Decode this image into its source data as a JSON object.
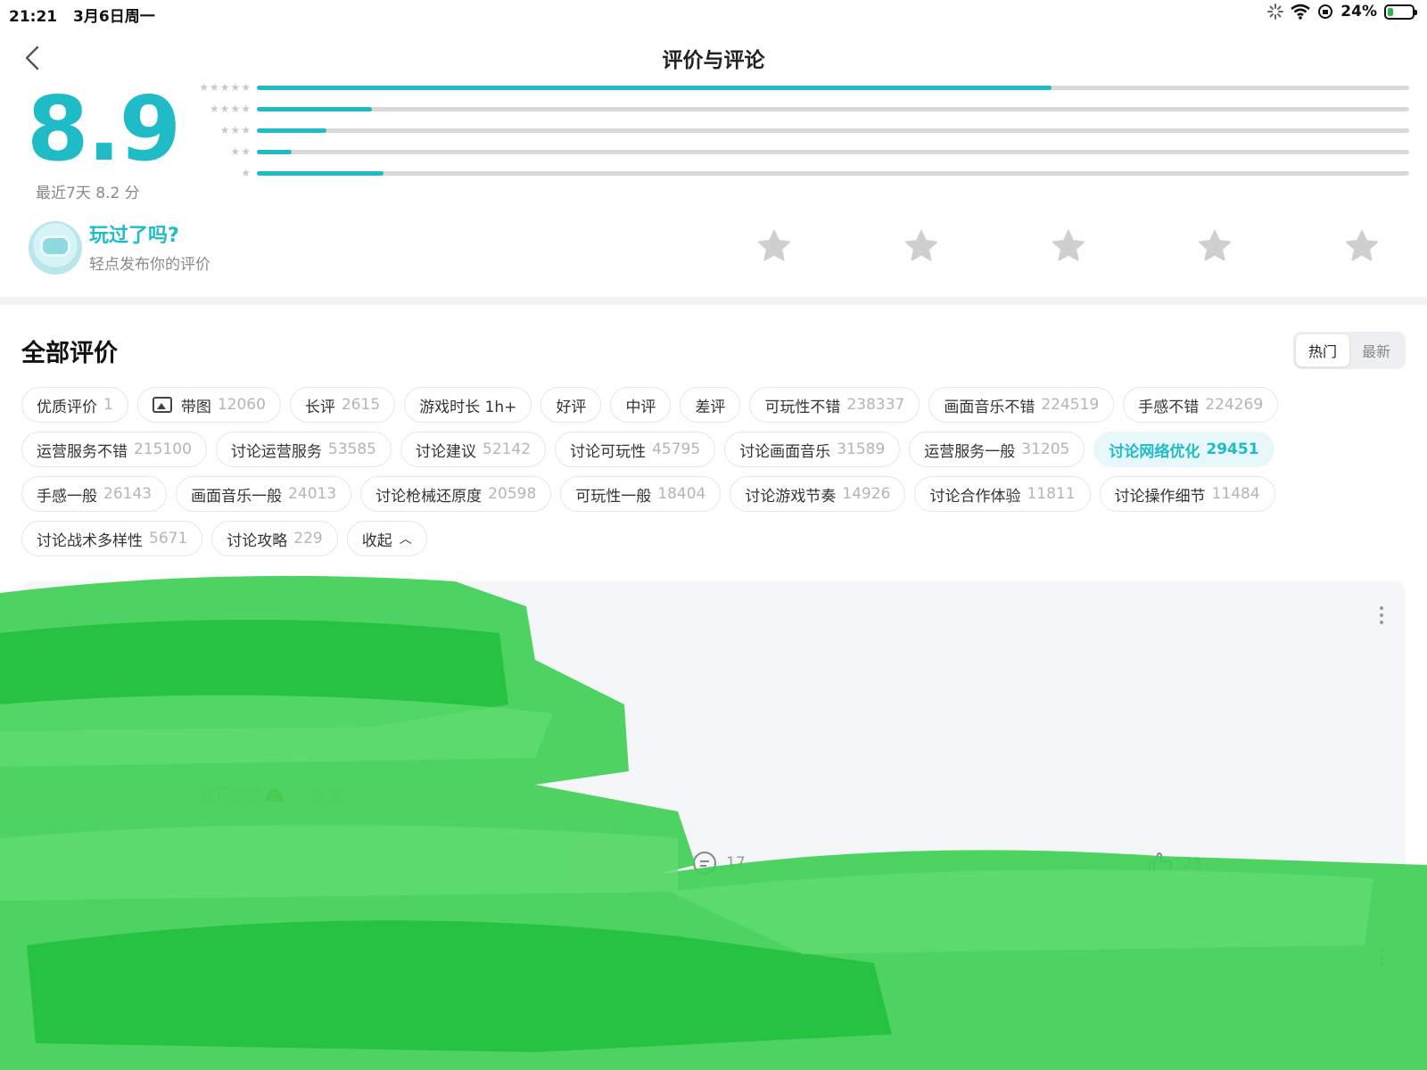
{
  "status_bar": {
    "time": "21:21",
    "date": "3月6日周一",
    "battery": "24%",
    "battery_level": 0.24
  },
  "header": {
    "title": "评价与评论",
    "back_icon": "chevron-left-icon"
  },
  "rating": {
    "score": "8.9",
    "recent": "最近7天 8.2 分",
    "distribution": [
      {
        "stars": 5,
        "fraction": 0.69
      },
      {
        "stars": 4,
        "fraction": 0.1
      },
      {
        "stars": 3,
        "fraction": 0.06
      },
      {
        "stars": 2,
        "fraction": 0.03
      },
      {
        "stars": 1,
        "fraction": 0.11
      }
    ]
  },
  "prompt": {
    "title": "玩过了吗?",
    "subtitle": "轻点发布你的评价"
  },
  "reviews": {
    "title": "全部评价",
    "sort": [
      "热门",
      "最新"
    ],
    "tags": [
      {
        "label": "优质评价",
        "count": "1"
      },
      {
        "label": "带图",
        "count": "12060",
        "icon": "image-icon"
      },
      {
        "label": "长评",
        "count": "2615"
      },
      {
        "label": "游戏时长 1h+",
        "count": ""
      },
      {
        "label": "好评",
        "count": ""
      },
      {
        "label": "中评",
        "count": ""
      },
      {
        "label": "差评",
        "count": ""
      },
      {
        "label": "可玩性不错",
        "count": "238337"
      },
      {
        "label": "画面音乐不错",
        "count": "224519"
      },
      {
        "label": "手感不错",
        "count": "224269"
      },
      {
        "label": "运营服务不错",
        "count": "215100"
      },
      {
        "label": "讨论运营服务",
        "count": "53585"
      },
      {
        "label": "讨论建议",
        "count": "52142"
      },
      {
        "label": "讨论可玩性",
        "count": "45795"
      },
      {
        "label": "讨论画面音乐",
        "count": "31589"
      },
      {
        "label": "运营服务一般",
        "count": "31205"
      },
      {
        "label": "讨论网络优化",
        "count": "29451",
        "selected": true
      },
      {
        "label": "手感一般",
        "count": "26143"
      },
      {
        "label": "画面音乐一般",
        "count": "24013"
      },
      {
        "label": "讨论枪械还原度",
        "count": "20598"
      },
      {
        "label": "可玩性一般",
        "count": "18404"
      },
      {
        "label": "讨论游戏节奏",
        "count": "14926"
      },
      {
        "label": "讨论合作体验",
        "count": "11811"
      },
      {
        "label": "讨论操作细节",
        "count": "11484"
      },
      {
        "label": "讨论战术多样性",
        "count": "5671"
      },
      {
        "label": "讨论攻略",
        "count": "229"
      }
    ],
    "collapse_label": "收起",
    "card1": {
      "text": "注可爱的🙈 … 全文",
      "comments": "17",
      "likes": "23"
    }
  }
}
